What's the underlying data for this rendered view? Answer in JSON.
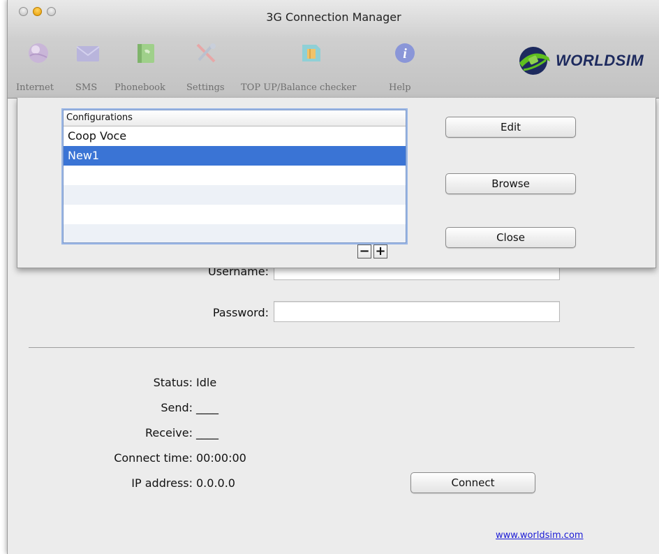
{
  "window": {
    "title": "3G Connection Manager"
  },
  "toolbar": {
    "items": [
      {
        "label": "Internet",
        "icon": "globe-icon"
      },
      {
        "label": "SMS",
        "icon": "envelope-icon"
      },
      {
        "label": "Phonebook",
        "icon": "phonebook-icon"
      },
      {
        "label": "Settings",
        "icon": "settings-tools-icon"
      },
      {
        "label": "TOP UP/Balance checker",
        "icon": "sim-card-icon"
      },
      {
        "label": "Help",
        "icon": "info-icon"
      }
    ],
    "logo_text": "WORLDSIM"
  },
  "sheet": {
    "list_header": "Configurations",
    "items": [
      "Coop Voce",
      "New1"
    ],
    "selected_index": 1,
    "buttons": {
      "edit": "Edit",
      "browse": "Browse",
      "close": "Close"
    },
    "remove_label": "−",
    "add_label": "+"
  },
  "form": {
    "username_label": "Username:",
    "username_value": "",
    "password_label": "Password:",
    "password_value": ""
  },
  "status": {
    "status_label": "Status:",
    "status_value": "Idle",
    "send_label": "Send:",
    "send_value": "____",
    "receive_label": "Receive:",
    "receive_value": "____",
    "connect_time_label": "Connect time:",
    "connect_time_value": "00:00:00",
    "ip_label": "IP address:",
    "ip_value": "0.0.0.0"
  },
  "connect_button": "Connect",
  "website_link": "www.worldsim.com",
  "colors": {
    "selection": "#3a74d5",
    "link": "#1a1ad6",
    "logo_text": "#1d2a5e",
    "logo_green": "#5fbf1f"
  }
}
